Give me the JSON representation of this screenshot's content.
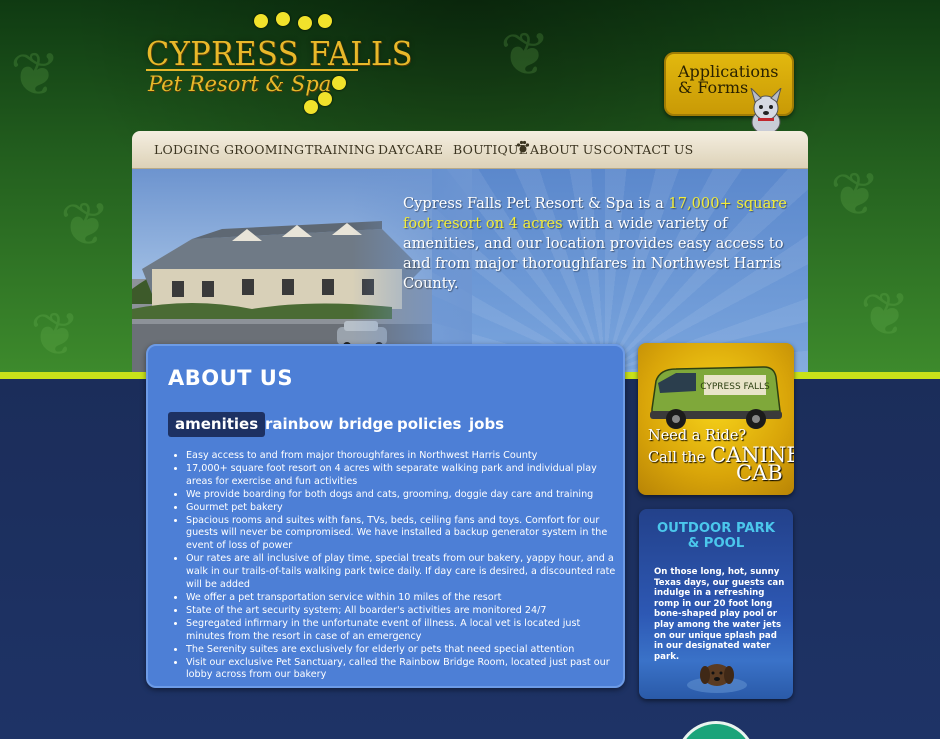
{
  "logo": {
    "name": "CYPRESS FALLS",
    "tagline": "Pet Resort & Spa"
  },
  "applications_button": {
    "line1": "Applications",
    "line2": "& Forms"
  },
  "nav": {
    "items": [
      "LODGING",
      "GROOMING",
      "TRAINING",
      "DAYCARE",
      "BOUTIQUE",
      "ABOUT US",
      "CONTACT US"
    ]
  },
  "hero": {
    "text_a": "Cypress Falls Pet Resort & Spa is a ",
    "text_highlight": "17,000+ square foot resort on 4 acres",
    "text_b": " with a wide variety of amenities, and our location provides easy access to and from major thoroughfares in Northwest Harris County."
  },
  "about": {
    "title": "ABOUT US",
    "tabs": [
      "amenities",
      "rainbow bridge",
      "policies",
      "jobs"
    ],
    "active_tab": "amenities",
    "items": [
      "Easy access to and from major thoroughfares in Northwest Harris County",
      "17,000+ square foot resort on 4 acres with separate walking park and individual play areas for exercise and fun activities",
      "We provide boarding for both dogs and cats, grooming, doggie day care and training",
      "Gourmet pet bakery",
      "Spacious rooms and suites with fans, TVs, beds, ceiling fans and toys. Comfort for our guests will never be compromised. We have installed a backup generator system in the event of loss of power",
      "Our rates are all inclusive of play time, special treats from our bakery, yappy hour, and a walk in our trails-of-tails walking park twice daily. If day care is desired, a discounted rate will be added",
      "We offer a pet transportation service within 10 miles of the resort",
      "State of the art security system; All boarder's activities are monitored 24/7",
      "Segregated infirmary in the unfortunate event of illness. A local vet is located just minutes from the resort in case of an emergency",
      "The Serenity suites are exclusively for elderly or pets that need special attention",
      "Visit our exclusive Pet Sanctuary, called the Rainbow Bridge Room, located just past our lobby across from our bakery"
    ]
  },
  "canine_cab": {
    "line1": "Need a Ride?",
    "line2_a": "Call the ",
    "line2_b": "CANINE",
    "line3": "CAB"
  },
  "outdoor_park": {
    "title_line1": "OUTDOOR PARK",
    "title_line2": "& POOL",
    "text": "On those long, hot, sunny Texas days, our guests can indulge in a refreshing romp in our 20 foot long bone-shaped play pool or play among the water jets on our unique splash pad in our designated water park."
  },
  "colors": {
    "lime_accent": "#c9e21a",
    "gold": "#e8b82a",
    "panel_blue": "#4d7fd6",
    "navy": "#1d2f5c",
    "park_title": "#4bc7ec",
    "hero_highlight": "#f2ec3a"
  }
}
